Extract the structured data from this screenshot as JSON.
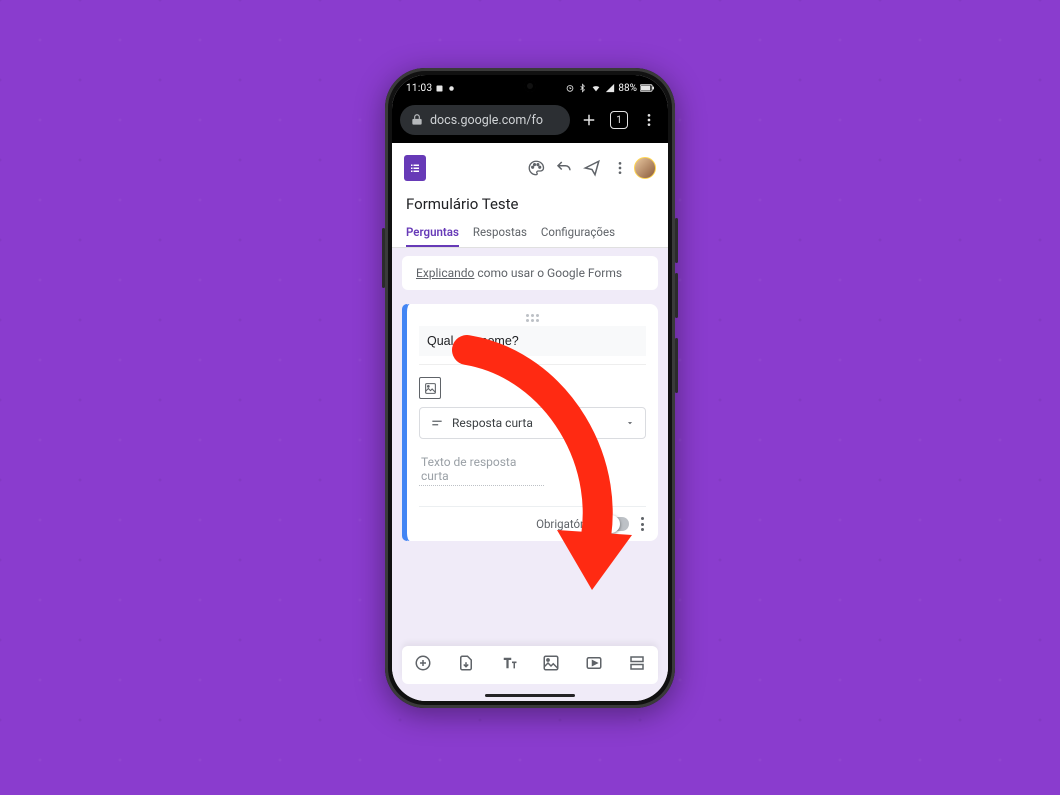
{
  "statusbar": {
    "time": "11:03",
    "battery_text": "88%"
  },
  "browser": {
    "url_text": "docs.google.com/fo",
    "tab_count": "1"
  },
  "form": {
    "title": "Formulário Teste",
    "tabs": {
      "questions": "Perguntas",
      "responses": "Respostas",
      "settings": "Configurações"
    },
    "description_underlined": "Explicando",
    "description_rest": " como usar o Google Forms"
  },
  "question": {
    "title": "Qual seu nome?",
    "answer_type_label": "Resposta curta",
    "answer_placeholder": "Texto de resposta curta",
    "required_label": "Obrigatória"
  }
}
